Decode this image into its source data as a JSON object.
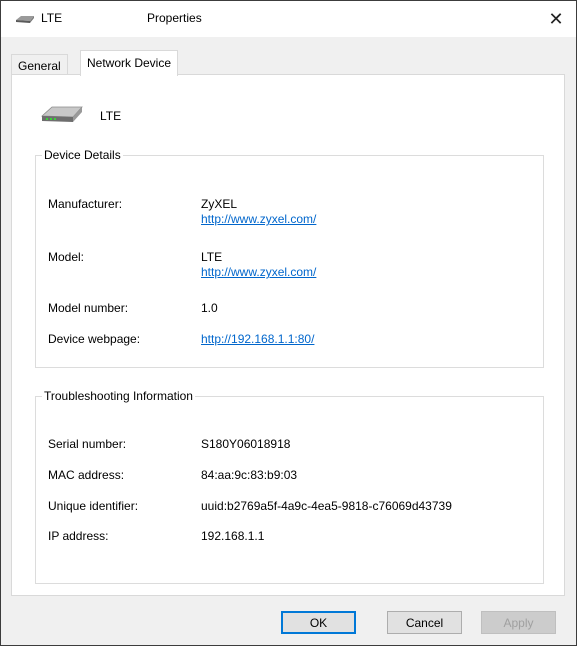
{
  "titlebar": {
    "device_name": "LTE",
    "caption": "Properties",
    "close_glyph": "✕"
  },
  "tabs": [
    {
      "label": "General",
      "active": false
    },
    {
      "label": "Network Device",
      "active": true
    }
  ],
  "device": {
    "name": "LTE",
    "icon": "network-device-icon"
  },
  "device_details": {
    "title": "Device Details",
    "manufacturer_label": "Manufacturer:",
    "manufacturer_value": "ZyXEL",
    "manufacturer_url": "http://www.zyxel.com/",
    "model_label": "Model:",
    "model_value": "LTE",
    "model_url": "http://www.zyxel.com/",
    "model_number_label": "Model number:",
    "model_number_value": "1.0",
    "webpage_label": "Device webpage:",
    "webpage_url": "http://192.168.1.1:80/"
  },
  "troubleshooting": {
    "title": "Troubleshooting Information",
    "serial_label": "Serial number:",
    "serial_value": "S180Y06018918",
    "mac_label": "MAC address:",
    "mac_value": "84:aa:9c:83:b9:03",
    "uid_label": "Unique identifier:",
    "uid_value": "uuid:b2769a5f-4a9c-4ea5-9818-c76069d43739",
    "ip_label": "IP address:",
    "ip_value": "192.168.1.1"
  },
  "buttons": {
    "ok": "OK",
    "cancel": "Cancel",
    "apply": "Apply"
  },
  "colors": {
    "link": "#0066cc",
    "accent": "#0078d7"
  }
}
